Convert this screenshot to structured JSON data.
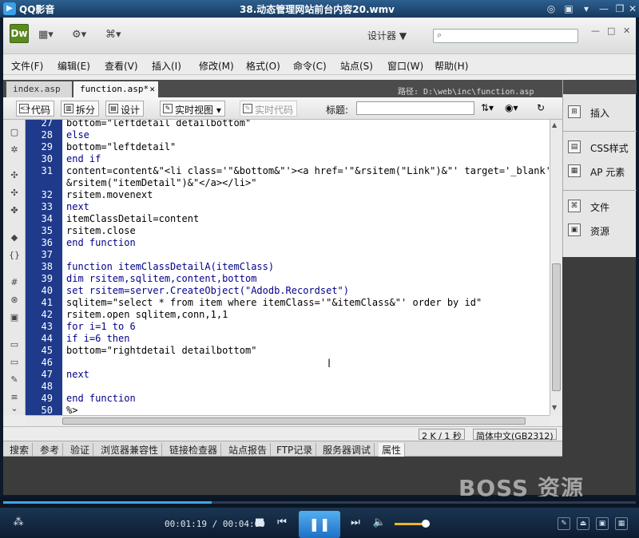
{
  "player": {
    "app_name": "QQ影音",
    "file_title": "38.动态管理网站前台内容20.wmv",
    "time": "00:01:19 / 00:04:00",
    "progress": 0.33,
    "volume": 0.8
  },
  "dw": {
    "logo": "Dw",
    "workspace": "设计器 ▼",
    "menu": [
      "文件(F)",
      "编辑(E)",
      "查看(V)",
      "插入(I)",
      "修改(M)",
      "格式(O)",
      "命令(C)",
      "站点(S)",
      "窗口(W)",
      "帮助(H)"
    ],
    "tabs": [
      "index.asp",
      "function.asp*"
    ],
    "path": "路径:  D:\\web\\inc\\function.asp",
    "view_buttons": {
      "code": "代码",
      "split": "拆分",
      "design": "设计",
      "live_view": "实时视图",
      "live_code": "实时代码"
    },
    "title_label": "标题:",
    "status": {
      "size": "2 K / 1 秒",
      "encoding": "简体中文(GB2312)"
    },
    "panel_tabs": [
      "搜索",
      "参考",
      "验证",
      "浏览器兼容性",
      "链接检查器",
      "站点报告",
      "FTP记录",
      "服务器调试",
      "属性"
    ],
    "right_panel": [
      "插入",
      "CSS样式",
      "AP 元素",
      "文件",
      "资源"
    ]
  },
  "code_lines": [
    {
      "n": "27",
      "t": "bottom=\"leftdetail detailbottom\""
    },
    {
      "n": "28",
      "t": "else"
    },
    {
      "n": "29",
      "t": "bottom=\"leftdetail\""
    },
    {
      "n": "30",
      "t": "end if"
    },
    {
      "n": "31",
      "t": "content=content&\"<li class='\"&bottom&\"'><a href='\"&rsitem(\"Link\")&\"' target='_blank'>\""
    },
    {
      "n": "",
      "t": "&rsitem(\"itemDetail\")&\"</a></li>\""
    },
    {
      "n": "32",
      "t": "rsitem.movenext"
    },
    {
      "n": "33",
      "t": "next"
    },
    {
      "n": "34",
      "t": "itemClassDetail=content"
    },
    {
      "n": "35",
      "t": "rsitem.close"
    },
    {
      "n": "36",
      "t": "end function"
    },
    {
      "n": "37",
      "t": ""
    },
    {
      "n": "38",
      "t": "function itemClassDetailA(itemClass)"
    },
    {
      "n": "39",
      "t": "dim rsitem,sqlitem,content,bottom"
    },
    {
      "n": "40",
      "t": "set rsitem=server.CreateObject(\"Adodb.Recordset\")"
    },
    {
      "n": "41",
      "t": "sqlitem=\"select * from item where itemClass='\"&itemClass&\"' order by id\""
    },
    {
      "n": "42",
      "t": "rsitem.open sqlitem,conn,1,1"
    },
    {
      "n": "43",
      "t": "for i=1 to 6"
    },
    {
      "n": "44",
      "t": "if i=6 then"
    },
    {
      "n": "45",
      "t": "bottom=\"rightdetail detailbottom\""
    },
    {
      "n": "46",
      "t": ""
    },
    {
      "n": "47",
      "t": "next"
    },
    {
      "n": "48",
      "t": ""
    },
    {
      "n": "49",
      "t": "end function"
    },
    {
      "n": "50",
      "t": "%>"
    }
  ],
  "watermark": "BOSS 资源"
}
